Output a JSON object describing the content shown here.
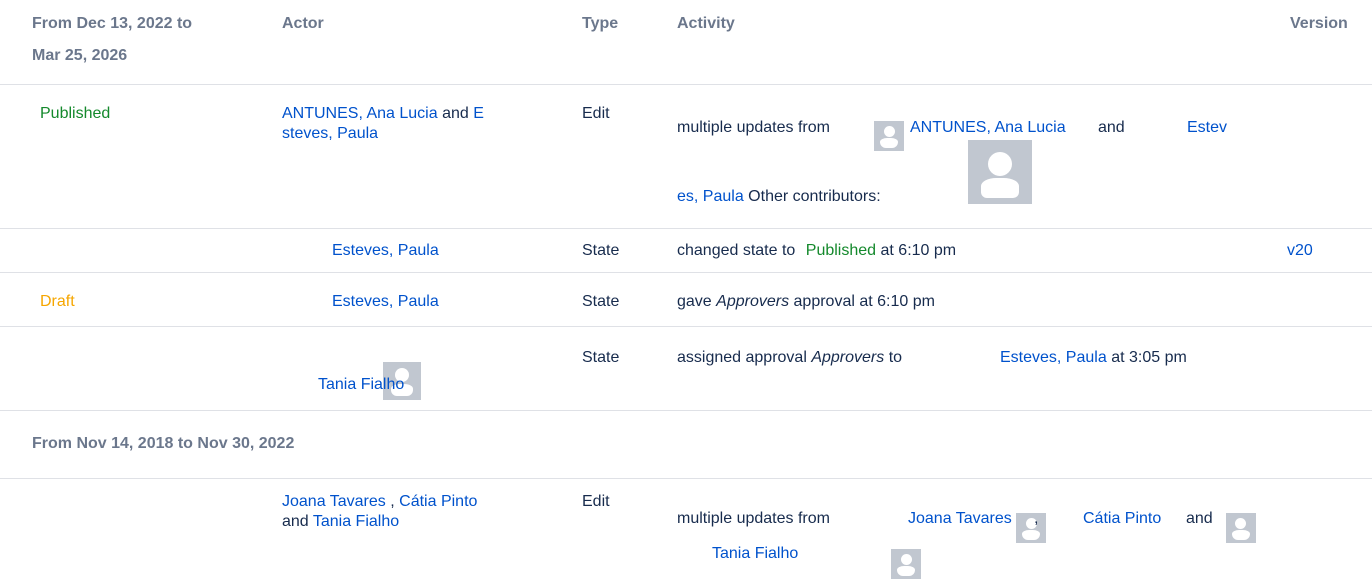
{
  "headers": {
    "period_line1": "From Dec 13, 2022 to",
    "period_line2": "Mar 25, 2026",
    "actor": "Actor",
    "type": "Type",
    "activity": "Activity",
    "version": "Version"
  },
  "rows": [
    {
      "state": "Published",
      "actor_a_line1": "ANTUNES, Ana Lucia",
      "actor_and": "and",
      "actor_b_part1": "E",
      "actor_b_part2": "steves, Paula",
      "type": "Edit",
      "activity_prefix": "multiple updates from",
      "activity_user1": "ANTUNES, Ana Lucia",
      "activity_and": "and",
      "activity_user2_part1": "Estev",
      "activity_user2_part2": "es, Paula",
      "activity_suffix": "Other contributors:"
    },
    {
      "actor": "Esteves, Paula",
      "type": "State",
      "activity_prefix": "changed state to",
      "activity_state": "Published",
      "activity_suffix": "at 6:10 pm",
      "version": "v20"
    },
    {
      "state": "Draft",
      "actor": "Esteves, Paula",
      "type": "State",
      "activity_prefix": "gave",
      "activity_em": "Approvers",
      "activity_suffix": "approval at 6:10 pm"
    },
    {
      "actor": "Tania Fialho",
      "type": "State",
      "activity_prefix": "assigned approval",
      "activity_em": "Approvers",
      "activity_to": "to",
      "activity_user": "Esteves, Paula",
      "activity_suffix": "at 3:05 pm"
    }
  ],
  "section2": {
    "title": "From Nov 14, 2018 to Nov 30, 2022",
    "row": {
      "actor1": "Joana Tavares",
      "comma": ",",
      "actor2": "Cátia Pinto",
      "and": "and",
      "actor3": "Tania Fialho",
      "type": "Edit",
      "activity_prefix": "multiple updates from",
      "activity_user1": "Joana Tavares",
      "activity_comma": ",",
      "activity_user2": "Cátia Pinto",
      "activity_and": "and",
      "activity_user3": "Tania Fialho"
    }
  },
  "icons": {
    "avatar": "default-user-avatar-icon"
  },
  "colors": {
    "link": "#0052cc",
    "published": "#14892c",
    "draft": "#f6a600",
    "header": "#6b778c",
    "divider": "#dfe1e6"
  }
}
